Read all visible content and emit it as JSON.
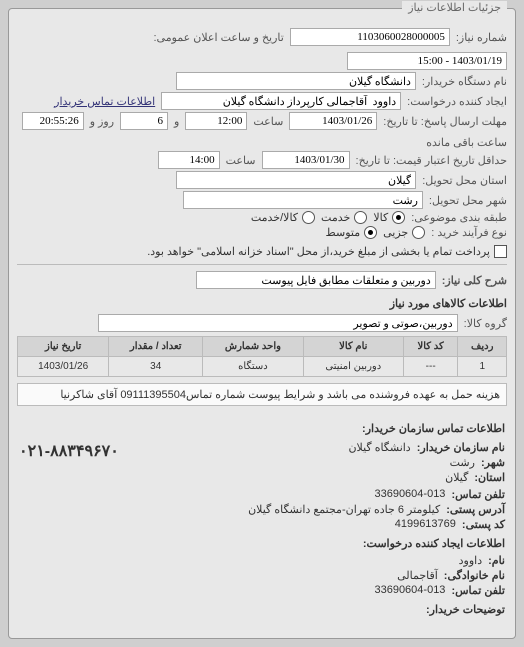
{
  "panel": {
    "title": "جزئیات اطلاعات نیاز"
  },
  "fields": {
    "request_no_label": "شماره نیاز:",
    "request_no": "1103060028000005",
    "public_datetime_label": "تاریخ و ساعت اعلان عمومی:",
    "public_datetime": "1403/01/19 - 15:00",
    "buyer_name_label": "نام دستگاه خریدار:",
    "buyer_name": "دانشگاه گیلان",
    "creator_label": "ایجاد کننده درخواست:",
    "creator": "داوود  آقاجمالی کارپرداز دانشگاه گیلان",
    "buyer_contact_label": "اطلاعات تماس خریدار",
    "deadline_label": "مهلت ارسال پاسخ: تا تاریخ:",
    "deadline_date": "1403/01/26",
    "time_label": "ساعت",
    "deadline_time": "12:00",
    "and_label": "و",
    "day_label": "روز و",
    "days_remain": "6",
    "hours_remain_label": "ساعت باقی مانده",
    "hours_remain": "20:55:26",
    "validity_label": "حداقل تاریخ اعتبار قیمت: تا تاریخ:",
    "validity_date": "1403/01/30",
    "validity_time": "14:00",
    "province_label": "استان محل تحویل:",
    "province": "گیلان",
    "city_label": "شهر محل تحویل:",
    "city": "رشت",
    "item_type_label": "طبقه بندی موضوعی:",
    "opt_goods": "کالا",
    "opt_service": "خدمت",
    "opt_goods_service": "کالا/خدمت",
    "purchase_type_label": "نوع فرآیند خرید :",
    "opt_small": "جزیی",
    "opt_medium": "متوسط",
    "purchase_note": "پرداخت تمام یا بخشی از مبلغ خرید،از محل \"اسناد خزانه اسلامی\" خواهد بود.",
    "general_desc_label": "شرح کلی نیاز:",
    "general_desc": "دوربین و متعلقات مطابق فایل پیوست",
    "goods_section": "اطلاعات کالاهای مورد نیاز",
    "group_label": "گروه کالا:",
    "group_value": "دوربین،صوتی و تصویر",
    "note_text": "هزینه حمل به عهده فروشنده می باشد و شرایط پیوست شماره تماس09111395504 آقای شاکرنیا"
  },
  "table": {
    "headers": {
      "row": "ردیف",
      "code": "کد کالا",
      "name": "نام کالا",
      "unit": "واحد شمارش",
      "qty": "تعداد / مقدار",
      "date": "تاریخ نیاز"
    },
    "rows": [
      {
        "row": "1",
        "code": "---",
        "name": "دوربین امنیتی",
        "unit": "دستگاه",
        "qty": "34",
        "date": "1403/01/26"
      }
    ]
  },
  "contact": {
    "section_title": "اطلاعات تماس سازمان خریدار:",
    "org_label": "نام سازمان خریدار:",
    "org": "دانشگاه گیلان",
    "city_label": "شهر:",
    "city": "رشت",
    "province_label": "استان:",
    "province": "گیلان",
    "phone_label": "تلفن تماس:",
    "phone": "33690604-013",
    "address_label": "آدرس پستی:",
    "address": "کیلومتر 6 جاده تهران-مجتمع دانشگاه گیلان",
    "postal_label": "کد پستی:",
    "postal": "4199613769",
    "creator_section": "اطلاعات ایجاد کننده درخواست:",
    "fname_label": "نام:",
    "fname": "داوود",
    "lname_label": "نام خانوادگی:",
    "lname": "آقاجمالی",
    "cphone_label": "تلفن تماس:",
    "cphone": "33690604-013",
    "desc_label": "توضیحات خریدار:",
    "big_phone": "۰۲۱-۸۸۳۴۹۶۷۰"
  }
}
